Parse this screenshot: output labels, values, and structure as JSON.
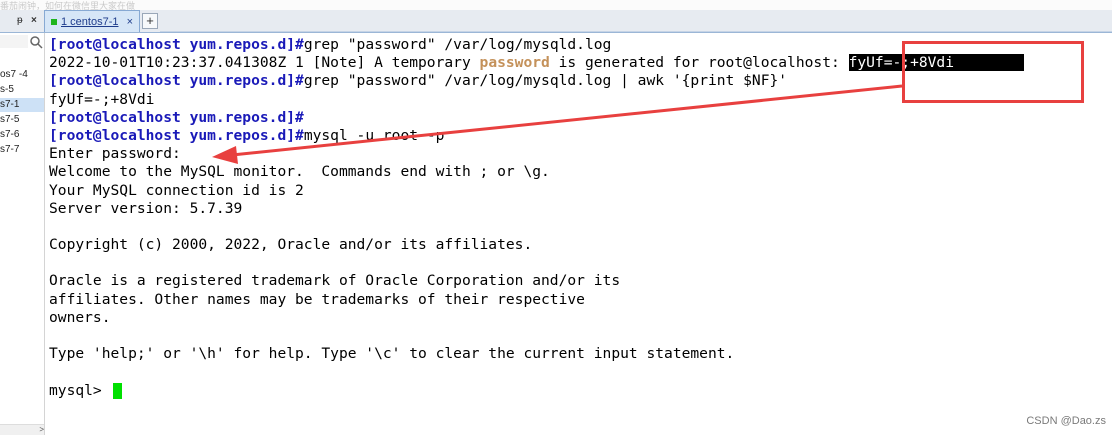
{
  "top_strip": {
    "faint_text": "番茄闹钟，如何在微信里大家在做"
  },
  "tabbar": {
    "pin_label": "ᵽ",
    "close_label": "×",
    "active_tab": {
      "label": "1 centos7-1",
      "close": "×"
    },
    "add_tab_label": "+"
  },
  "sidebar": {
    "items": [
      "os7 -4",
      "s-5",
      "s7-1",
      "s7-5",
      "s7-6",
      "s7-7"
    ],
    "selected_index": 2,
    "scroll_label": ">"
  },
  "terminal": {
    "lines": [
      {
        "segments": [
          {
            "text": "[root@localhost yum.repos.d]#",
            "style": "prompt"
          },
          {
            "text": "grep \"password\" /var/log/mysqld.log",
            "style": ""
          }
        ]
      },
      {
        "segments": [
          {
            "text": "2022-10-01T10:23:37.041308Z 1 [Note] A temporary ",
            "style": ""
          },
          {
            "text": "password",
            "style": "hl"
          },
          {
            "text": " is generated for root@localhost: ",
            "style": ""
          },
          {
            "text": "fyUf=-;+8Vdi        ",
            "style": "sel-text"
          }
        ]
      },
      {
        "segments": [
          {
            "text": "[root@localhost yum.repos.d]#",
            "style": "prompt"
          },
          {
            "text": "grep \"password\" /var/log/mysqld.log | awk '{print $NF}'",
            "style": ""
          }
        ]
      },
      {
        "segments": [
          {
            "text": "fyUf=-;+8Vdi",
            "style": ""
          }
        ]
      },
      {
        "segments": [
          {
            "text": "[root@localhost yum.repos.d]#",
            "style": "prompt"
          }
        ]
      },
      {
        "segments": [
          {
            "text": "[root@localhost yum.repos.d]#",
            "style": "prompt"
          },
          {
            "text": "mysql -u root -p",
            "style": ""
          }
        ]
      },
      {
        "segments": [
          {
            "text": "Enter password:",
            "style": ""
          }
        ]
      },
      {
        "segments": [
          {
            "text": "Welcome to the MySQL monitor.  Commands end with ; or \\g.",
            "style": ""
          }
        ]
      },
      {
        "segments": [
          {
            "text": "Your MySQL connection id is 2",
            "style": ""
          }
        ]
      },
      {
        "segments": [
          {
            "text": "Server version: 5.7.39",
            "style": ""
          }
        ]
      },
      {
        "segments": [
          {
            "text": "",
            "style": ""
          }
        ]
      },
      {
        "segments": [
          {
            "text": "Copyright (c) 2000, 2022, Oracle and/or its affiliates.",
            "style": ""
          }
        ]
      },
      {
        "segments": [
          {
            "text": "",
            "style": ""
          }
        ]
      },
      {
        "segments": [
          {
            "text": "Oracle is a registered trademark of Oracle Corporation and/or its",
            "style": ""
          }
        ]
      },
      {
        "segments": [
          {
            "text": "affiliates. Other names may be trademarks of their respective",
            "style": ""
          }
        ]
      },
      {
        "segments": [
          {
            "text": "owners.",
            "style": ""
          }
        ]
      },
      {
        "segments": [
          {
            "text": "",
            "style": ""
          }
        ]
      },
      {
        "segments": [
          {
            "text": "Type 'help;' or '\\h' for help. Type '\\c' to clear the current input statement.",
            "style": ""
          }
        ]
      },
      {
        "segments": [
          {
            "text": "",
            "style": ""
          }
        ]
      },
      {
        "segments": [
          {
            "text": "mysql> ",
            "style": ""
          }
        ],
        "cursor": true
      }
    ]
  },
  "colors": {
    "prompt": "#1a1ab8",
    "highlight_word": "#c4915a",
    "cursor": "#00e000",
    "annotation": "#e8403f"
  },
  "watermark": "CSDN @Dao.zs"
}
